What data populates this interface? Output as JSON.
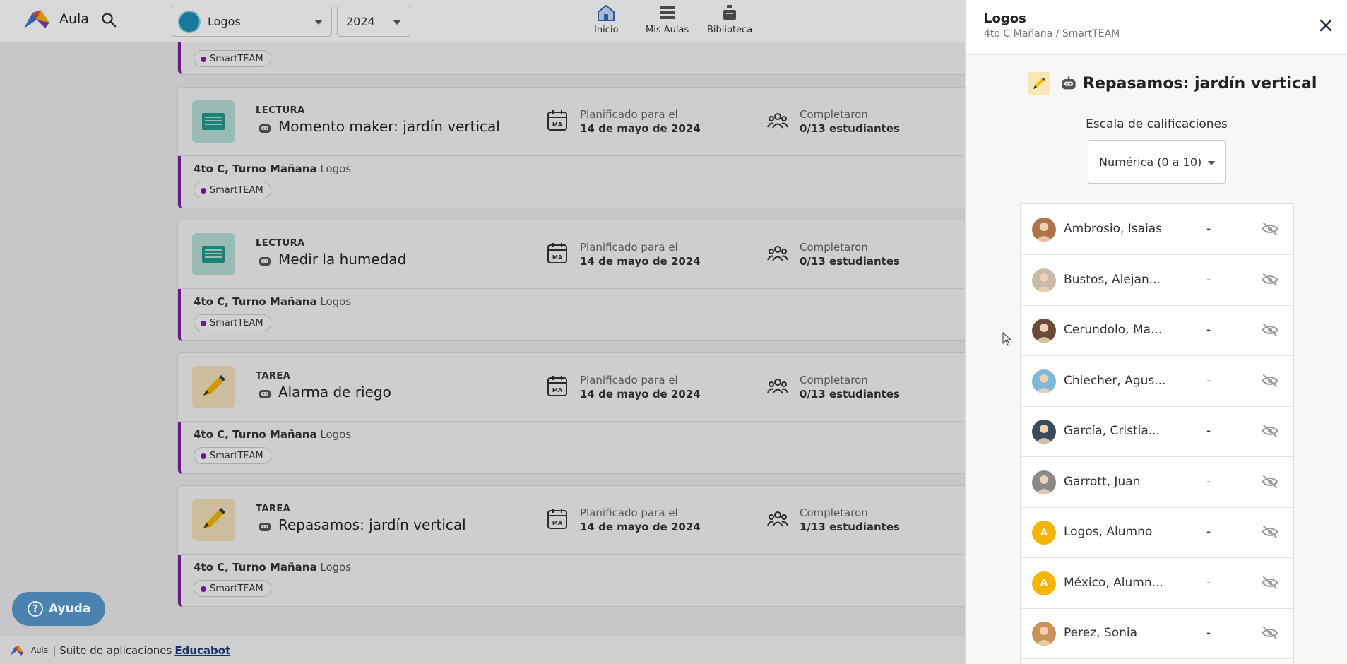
{
  "app": {
    "name": "Aula"
  },
  "topbar": {
    "school_select": "Logos",
    "year_select": "2024",
    "nav": [
      {
        "label": "Inicio",
        "icon": "home-icon"
      },
      {
        "label": "Mis Aulas",
        "icon": "classrooms-icon"
      },
      {
        "label": "Biblioteca",
        "icon": "library-icon"
      }
    ]
  },
  "list": {
    "partial_chip": "SmartTEAM",
    "cards": [
      {
        "type": "LECTURA",
        "title": "Momento maker: jardín vertical",
        "plan_label": "Planificado para el",
        "plan_date": "14 de mayo de 2024",
        "comp_label": "Completaron",
        "comp_value": "0/13 estudiantes",
        "group_bold": "4to C, Turno Mañana",
        "group_sub": "Logos",
        "chip": "SmartTEAM"
      },
      {
        "type": "LECTURA",
        "title": "Medir la humedad",
        "plan_label": "Planificado para el",
        "plan_date": "14 de mayo de 2024",
        "comp_label": "Completaron",
        "comp_value": "0/13 estudiantes",
        "group_bold": "4to C, Turno Mañana",
        "group_sub": "Logos",
        "chip": "SmartTEAM"
      },
      {
        "type": "TAREA",
        "title": "Alarma de riego",
        "plan_label": "Planificado para el",
        "plan_date": "14 de mayo de 2024",
        "comp_label": "Completaron",
        "comp_value": "0/13 estudiantes",
        "group_bold": "4to C, Turno Mañana",
        "group_sub": "Logos",
        "chip": "SmartTEAM"
      },
      {
        "type": "TAREA",
        "title": "Repasamos: jardín vertical",
        "plan_label": "Planificado para el",
        "plan_date": "14 de mayo de 2024",
        "comp_label": "Completaron",
        "comp_value": "1/13 estudiantes",
        "group_bold": "4to C, Turno Mañana",
        "group_sub": "Logos",
        "chip": "SmartTEAM"
      }
    ]
  },
  "help": {
    "label": "Ayuda",
    "glyph": "?"
  },
  "footer": {
    "mini_logo_text": "Aula",
    "text": "| Suite de aplicaciones",
    "brand": "Educabot"
  },
  "panel": {
    "title": "Logos",
    "subtitle": "4to C Mañana / SmartTEAM",
    "activity_title": "Repasamos: jardín vertical",
    "scale_label": "Escala de calificaciones",
    "scale_value": "Numérica (0 a 10)",
    "students": [
      {
        "name": "Ambrosio, Isaias",
        "grade": "-",
        "avatar": "photo",
        "color": "#b0724a"
      },
      {
        "name": "Bustos, Alejan...",
        "grade": "-",
        "avatar": "photo",
        "color": "#c9b9a8"
      },
      {
        "name": "Cerundolo, Ma...",
        "grade": "-",
        "avatar": "photo",
        "color": "#6b4a3a"
      },
      {
        "name": "Chiecher, Agus...",
        "grade": "-",
        "avatar": "photo",
        "color": "#7fb9d8"
      },
      {
        "name": "García, Cristia...",
        "grade": "-",
        "avatar": "photo",
        "color": "#3a4a5a"
      },
      {
        "name": "Garrott, Juan",
        "grade": "-",
        "avatar": "photo",
        "color": "#8a8a8a"
      },
      {
        "name": "Logos, Alumno",
        "grade": "-",
        "avatar": "A",
        "color": "#f5b400"
      },
      {
        "name": "México, Alumn...",
        "grade": "-",
        "avatar": "A",
        "color": "#f5b400"
      },
      {
        "name": "Perez, Sonia",
        "grade": "-",
        "avatar": "photo",
        "color": "#c9935a"
      }
    ]
  },
  "colors": {
    "accent_purple": "#7b1fa2",
    "help_blue": "#4a83b0",
    "avatar_yellow": "#f5b400"
  }
}
